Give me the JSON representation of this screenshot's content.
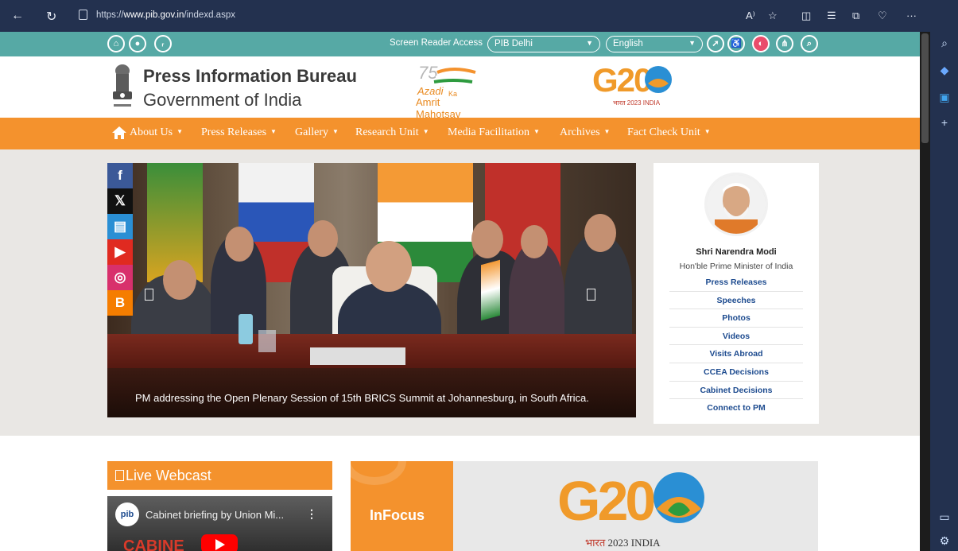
{
  "browser": {
    "url_prefix": "https://",
    "url_domain": "www.pib.gov.in",
    "url_path": "/indexd.aspx"
  },
  "topstrip": {
    "screen_reader_label": "Screen Reader Access",
    "region_select": "PIB Delhi",
    "language_select": "English",
    "left_icons": [
      "home-icon",
      "hindi-icon",
      "rss-icon"
    ],
    "right_icons": [
      "share-icon",
      "accessibility-icon",
      "contrast-icon",
      "sitemap-icon",
      "search-icon"
    ]
  },
  "header": {
    "title": "Press Information Bureau",
    "subtitle": "Government of India",
    "azadi_line1": "Azadi",
    "azadi_ka": "Ka",
    "azadi_line2": "Amrit Mahotsav",
    "azadi_75": "75",
    "g20_text": "G20",
    "g20_caption": "भारत 2023 INDIA"
  },
  "menu": {
    "items": [
      {
        "label": "About Us"
      },
      {
        "label": "Press Releases"
      },
      {
        "label": "Gallery"
      },
      {
        "label": "Research Unit"
      },
      {
        "label": "Media Facilitation"
      },
      {
        "label": "Archives"
      },
      {
        "label": "Fact Check Unit"
      }
    ]
  },
  "hero": {
    "caption": "PM addressing the Open Plenary Session of 15th BRICS Summit at Johannesburg, in South Africa."
  },
  "social": [
    {
      "icon": "facebook-icon",
      "glyph": "f",
      "color": "#3b5998"
    },
    {
      "icon": "x-icon",
      "glyph": "𝕏",
      "color": "#111111"
    },
    {
      "icon": "koo-icon",
      "glyph": "▤",
      "color": "#2a8fd4"
    },
    {
      "icon": "youtube-icon",
      "glyph": "▶",
      "color": "#e02a20"
    },
    {
      "icon": "instagram-icon",
      "glyph": "◎",
      "color": "#d8306c"
    },
    {
      "icon": "blogger-icon",
      "glyph": "B",
      "color": "#f57d00"
    }
  ],
  "pm": {
    "name": "Shri Narendra Modi",
    "role": "Hon'ble Prime Minister of India",
    "links": [
      "Press Releases",
      "Speeches",
      "Photos",
      "Videos",
      "Visits Abroad",
      "CCEA Decisions",
      "Cabinet Decisions",
      "Connect to PM"
    ]
  },
  "webcast": {
    "title": "Live Webcast",
    "video_title": "Cabinet briefing by Union Mi...",
    "video_logo": "pib",
    "video_overlay": "CABINE"
  },
  "infocus": {
    "label": "InFocus",
    "g20_text": "G20",
    "g20_caption_hi": "भारत",
    "g20_caption_en": "2023 INDIA"
  },
  "colors": {
    "teal": "#56a9a5",
    "orange": "#f4922d",
    "link_blue": "#1d4b8f"
  }
}
